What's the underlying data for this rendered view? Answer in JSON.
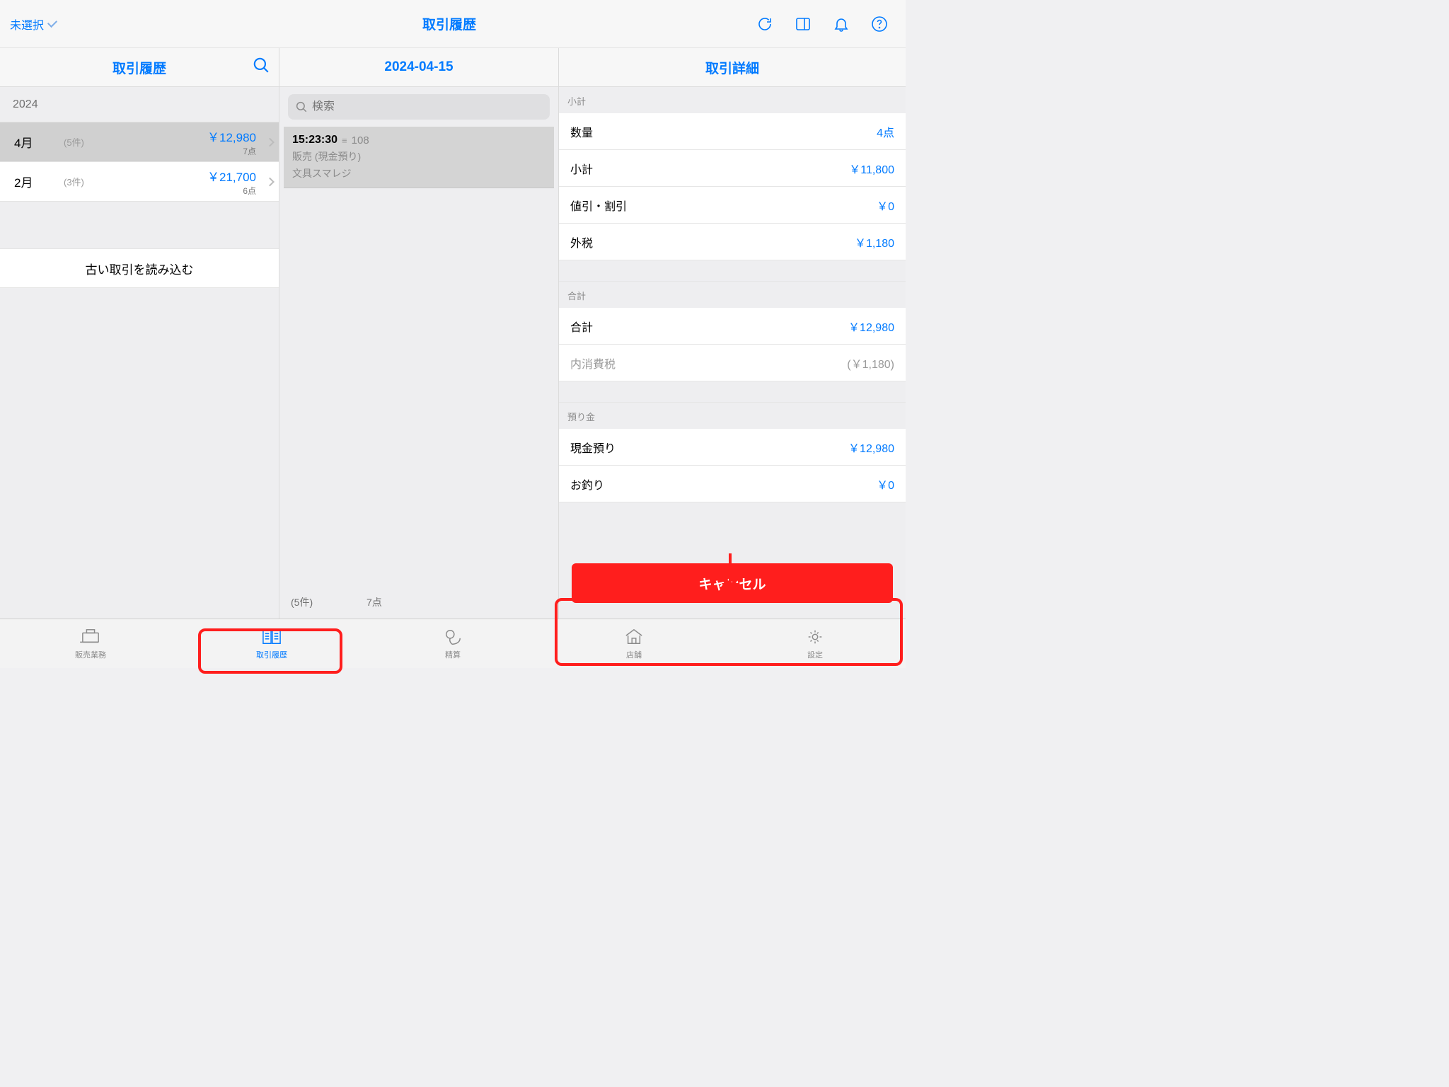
{
  "header": {
    "store_selector": "未選択",
    "title": "取引履歴"
  },
  "left_panel": {
    "title": "取引履歴",
    "year": "2024",
    "months": [
      {
        "label": "4月",
        "count": "(5件)",
        "amount": "￥12,980",
        "points": "7点",
        "selected": true
      },
      {
        "label": "2月",
        "count": "(3件)",
        "amount": "￥21,700",
        "points": "6点",
        "selected": false
      }
    ],
    "load_older": "古い取引を読み込む"
  },
  "mid_panel": {
    "title": "2024-04-15",
    "search_placeholder": "検索",
    "rows": [
      {
        "time": "15:23:30",
        "id": "108",
        "type": "販売 (現金預り)",
        "shop": "文具スマレジ"
      }
    ],
    "footer_left": "(5件)",
    "footer_mid": "7点"
  },
  "detail_panel": {
    "title": "取引詳細",
    "sections": {
      "subtotal_header": "小計",
      "qty_label": "数量",
      "qty_value": "4点",
      "subtotal_label": "小計",
      "subtotal_value": "￥11,800",
      "discount_label": "値引・割引",
      "discount_value": "￥0",
      "tax_label": "外税",
      "tax_value": "￥1,180",
      "total_header": "合計",
      "total_label": "合計",
      "total_value": "￥12,980",
      "inner_tax_label": "内消費税",
      "inner_tax_value": "(￥1,180)",
      "deposit_header": "預り金",
      "cash_label": "現金預り",
      "cash_value": "￥12,980",
      "change_label": "お釣り",
      "change_value": "￥0"
    },
    "cancel": "キャンセル"
  },
  "tabs": [
    {
      "id": "sales",
      "label": "販売業務"
    },
    {
      "id": "history",
      "label": "取引履歴"
    },
    {
      "id": "settle",
      "label": "精算"
    },
    {
      "id": "store",
      "label": "店舗"
    },
    {
      "id": "settings",
      "label": "設定"
    }
  ]
}
